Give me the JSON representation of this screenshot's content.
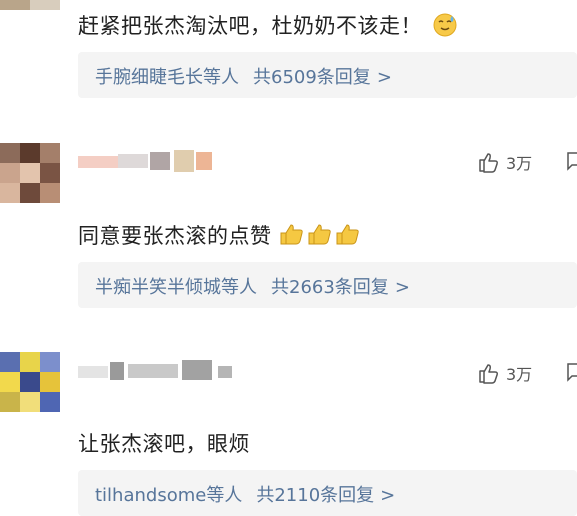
{
  "comments": [
    {
      "text": "赶紧把张杰淘汰吧，杜奶奶不该走！",
      "emoji": "sweat-smile-face",
      "reply": {
        "names": "手腕细睫毛长等人",
        "count": "共6509条回复",
        "chevron": ">"
      }
    },
    {
      "text": "同意要张杰滚的点赞",
      "emoji": "thumbs-up",
      "likes": "3万",
      "reply": {
        "names": "半痴半笑半倾城等人",
        "count": "共2663条回复",
        "chevron": ">"
      }
    },
    {
      "text": "让张杰滚吧，眼烦",
      "likes": "3万",
      "reply": {
        "names": "tilhandsome等人",
        "count": "共2110条回复",
        "chevron": ">"
      }
    }
  ],
  "colors": {
    "link": "#57759a",
    "reply_bg": "#f4f4f4",
    "text": "#222222"
  }
}
